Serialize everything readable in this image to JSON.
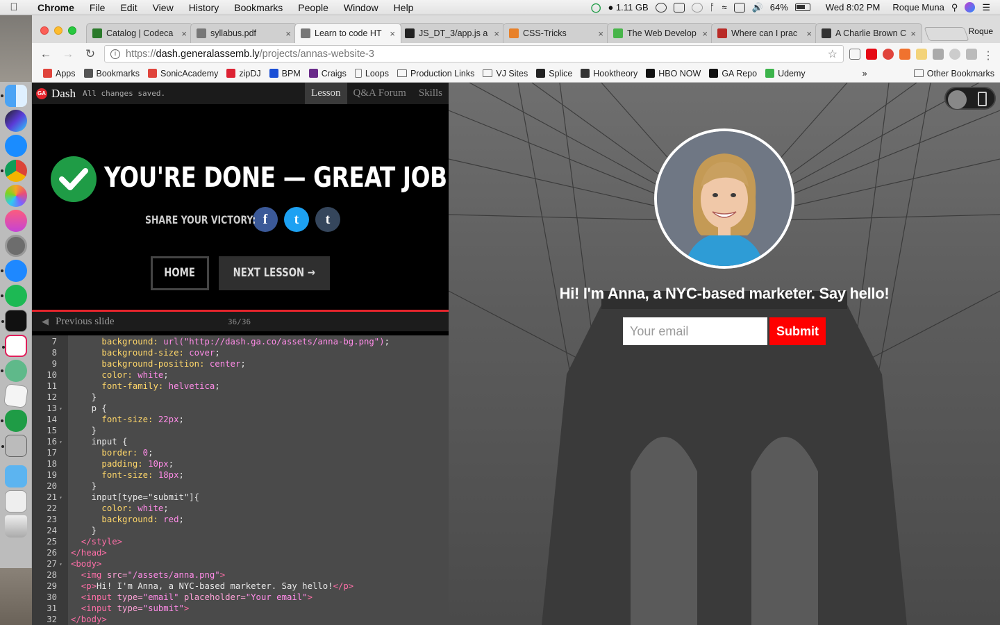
{
  "menubar": {
    "app": "Chrome",
    "items": [
      "File",
      "Edit",
      "View",
      "History",
      "Bookmarks",
      "People",
      "Window",
      "Help"
    ],
    "memory": "1.11 GB",
    "battery": "64%",
    "clock": "Wed 8:02 PM",
    "user": "Roque Muna"
  },
  "tabs": [
    {
      "title": "Catalog | Codeca",
      "color": "#2b7a2b"
    },
    {
      "title": "syllabus.pdf",
      "color": "#777777"
    },
    {
      "title": "Learn to code HT",
      "color": "#777777",
      "active": true
    },
    {
      "title": "JS_DT_3/app.js a",
      "color": "#222222"
    },
    {
      "title": "CSS-Tricks",
      "color": "#e8812a"
    },
    {
      "title": "The Web Develop",
      "color": "#48b54a"
    },
    {
      "title": "Where can I prac",
      "color": "#b92b27"
    },
    {
      "title": "A Charlie Brown C",
      "color": "#333333"
    }
  ],
  "profile": "Roque",
  "address": {
    "scheme": "https://",
    "host": "dash.generalassemb.ly",
    "path": "/projects/annas-website-3"
  },
  "bookmarks": [
    {
      "label": "Apps",
      "color": "#e0443c"
    },
    {
      "label": "Bookmarks",
      "color": "#555555"
    },
    {
      "label": "SonicAcademy",
      "color": "#e0443c"
    },
    {
      "label": "zipDJ",
      "color": "#d23"
    },
    {
      "label": "BPM",
      "color": "#1a4fd6"
    },
    {
      "label": "Craigs",
      "color": "#6a2b8a"
    },
    {
      "label": "Loops",
      "color": "#888888",
      "doc": true
    },
    {
      "label": "Production Links",
      "folder": true
    },
    {
      "label": "VJ Sites",
      "folder": true
    },
    {
      "label": "Splice",
      "color": "#222222"
    },
    {
      "label": "Hooktheory",
      "color": "#333333"
    },
    {
      "label": "HBO NOW",
      "color": "#111111"
    },
    {
      "label": "GA Repo",
      "color": "#111111"
    },
    {
      "label": "Udemy",
      "color": "#3cb44b"
    }
  ],
  "other_bookmarks": "Other Bookmarks",
  "dash": {
    "title": "Dash",
    "status": "All changes saved.",
    "tabs": [
      "Lesson",
      "Q&A Forum",
      "Skills"
    ],
    "done_title": "YOU'RE DONE — GREAT JOB!",
    "share_label": "SHARE YOUR VICTORY:",
    "social": [
      {
        "icon": "facebook-icon",
        "glyph": "f",
        "color": "#3b5998"
      },
      {
        "icon": "twitter-icon",
        "glyph": "t",
        "color": "#1da1f2"
      },
      {
        "icon": "tumblr-icon",
        "glyph": "t",
        "color": "#35465c"
      }
    ],
    "home_label": "HOME",
    "next_label": "NEXT LESSON →",
    "prev_slide": "Previous slide",
    "slide_count": "36/36"
  },
  "editor": {
    "lines": [
      {
        "n": "7",
        "segs": [
          [
            "k",
            "      background: "
          ],
          [
            "s",
            "url(\"http://dash.ga.co/assets/anna-bg.png\")"
          ],
          [
            "p",
            ";"
          ]
        ]
      },
      {
        "n": "8",
        "segs": [
          [
            "k",
            "      background-size: "
          ],
          [
            "v",
            "cover"
          ],
          [
            "p",
            ";"
          ]
        ]
      },
      {
        "n": "9",
        "segs": [
          [
            "k",
            "      background-position: "
          ],
          [
            "v",
            "center"
          ],
          [
            "p",
            ";"
          ]
        ]
      },
      {
        "n": "10",
        "segs": [
          [
            "k",
            "      color: "
          ],
          [
            "v",
            "white"
          ],
          [
            "p",
            ";"
          ]
        ]
      },
      {
        "n": "11",
        "segs": [
          [
            "k",
            "      font-family: "
          ],
          [
            "v",
            "helvetica"
          ],
          [
            "p",
            ";"
          ]
        ]
      },
      {
        "n": "12",
        "segs": [
          [
            "p",
            "    }"
          ]
        ]
      },
      {
        "n": "13",
        "fold": true,
        "segs": [
          [
            "p",
            "    p {"
          ]
        ]
      },
      {
        "n": "14",
        "segs": [
          [
            "k",
            "      font-size: "
          ],
          [
            "v",
            "22px"
          ],
          [
            "p",
            ";"
          ]
        ]
      },
      {
        "n": "15",
        "segs": [
          [
            "p",
            "    }"
          ]
        ]
      },
      {
        "n": "16",
        "fold": true,
        "segs": [
          [
            "p",
            "    input {"
          ]
        ]
      },
      {
        "n": "17",
        "segs": [
          [
            "k",
            "      border: "
          ],
          [
            "v",
            "0"
          ],
          [
            "p",
            ";"
          ]
        ]
      },
      {
        "n": "18",
        "segs": [
          [
            "k",
            "      padding: "
          ],
          [
            "v",
            "10px"
          ],
          [
            "p",
            ";"
          ]
        ]
      },
      {
        "n": "19",
        "segs": [
          [
            "k",
            "      font-size: "
          ],
          [
            "v",
            "18px"
          ],
          [
            "p",
            ";"
          ]
        ]
      },
      {
        "n": "20",
        "segs": [
          [
            "p",
            "    }"
          ]
        ]
      },
      {
        "n": "21",
        "fold": true,
        "segs": [
          [
            "p",
            "    input[type=\"submit\"]{"
          ]
        ]
      },
      {
        "n": "22",
        "segs": [
          [
            "k",
            "      color: "
          ],
          [
            "v",
            "white"
          ],
          [
            "p",
            ";"
          ]
        ]
      },
      {
        "n": "23",
        "segs": [
          [
            "k",
            "      background: "
          ],
          [
            "v",
            "red"
          ],
          [
            "p",
            ";"
          ]
        ]
      },
      {
        "n": "24",
        "segs": [
          [
            "p",
            "    }"
          ]
        ]
      },
      {
        "n": "25",
        "segs": [
          [
            "t",
            "  </style>"
          ]
        ]
      },
      {
        "n": "26",
        "segs": [
          [
            "t",
            "</head>"
          ]
        ]
      },
      {
        "n": "27",
        "fold": true,
        "segs": [
          [
            "t",
            "<body>"
          ]
        ]
      },
      {
        "n": "28",
        "segs": [
          [
            "t",
            "  <img "
          ],
          [
            "a",
            "src="
          ],
          [
            "s",
            "\"/assets/anna.png\""
          ],
          [
            "t",
            ">"
          ]
        ]
      },
      {
        "n": "29",
        "segs": [
          [
            "t",
            "  <p>"
          ],
          [
            "p",
            "Hi! I'm Anna, a NYC-based marketer. Say hello!"
          ],
          [
            "t",
            "</p>"
          ]
        ]
      },
      {
        "n": "30",
        "segs": [
          [
            "t",
            "  <input "
          ],
          [
            "a",
            "type="
          ],
          [
            "s",
            "\"email\" "
          ],
          [
            "a",
            "placeholder="
          ],
          [
            "s",
            "\"Your email\""
          ],
          [
            "t",
            ">"
          ]
        ]
      },
      {
        "n": "31",
        "segs": [
          [
            "t",
            "  <input "
          ],
          [
            "a",
            "type="
          ],
          [
            "s",
            "\"submit\""
          ],
          [
            "t",
            ">"
          ]
        ]
      },
      {
        "n": "32",
        "segs": [
          [
            "t",
            "</body>"
          ]
        ]
      }
    ]
  },
  "preview": {
    "greeting": "Hi! I'm Anna, a NYC-based marketer. Say hello!",
    "email_placeholder": "Your email",
    "submit_label": "Submit"
  },
  "colors": {
    "ga_red": "#e5242c",
    "check_green": "#1f9c46",
    "submit_red": "#ff0000"
  }
}
